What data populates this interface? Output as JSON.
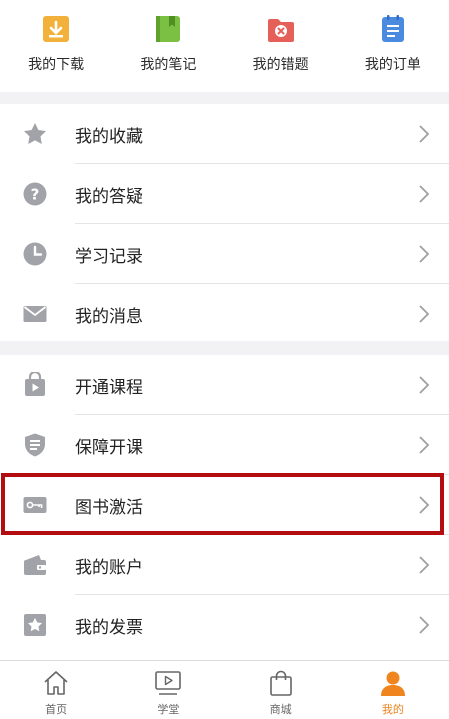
{
  "quick_actions": [
    {
      "label": "我的下载",
      "icon": "download-icon",
      "color": "#f2b13a"
    },
    {
      "label": "我的笔记",
      "icon": "notebook-icon",
      "color": "#7cc043"
    },
    {
      "label": "我的错题",
      "icon": "wrong-answers-folder-icon",
      "color": "#e6605a"
    },
    {
      "label": "我的订单",
      "icon": "order-list-icon",
      "color": "#4a8be0"
    }
  ],
  "section1": [
    {
      "label": "我的收藏",
      "icon": "star-icon"
    },
    {
      "label": "我的答疑",
      "icon": "question-icon"
    },
    {
      "label": "学习记录",
      "icon": "clock-icon"
    },
    {
      "label": "我的消息",
      "icon": "mail-icon"
    }
  ],
  "section2": [
    {
      "label": "开通课程",
      "icon": "course-bag-icon"
    },
    {
      "label": "保障开课",
      "icon": "shield-icon"
    },
    {
      "label": "图书激活",
      "icon": "book-key-icon"
    },
    {
      "label": "我的账户",
      "icon": "wallet-icon"
    },
    {
      "label": "我的发票",
      "icon": "invoice-star-icon"
    }
  ],
  "highlight_color": "#b30d12",
  "tabs": [
    {
      "label": "首页",
      "icon": "home-icon",
      "active": false
    },
    {
      "label": "学堂",
      "icon": "video-play-icon",
      "active": false
    },
    {
      "label": "商城",
      "icon": "shopping-bag-icon",
      "active": false
    },
    {
      "label": "我的",
      "icon": "user-icon",
      "active": true
    }
  ],
  "colors": {
    "icon_gray": "#a2a3a8",
    "accent": "#f0841e"
  }
}
